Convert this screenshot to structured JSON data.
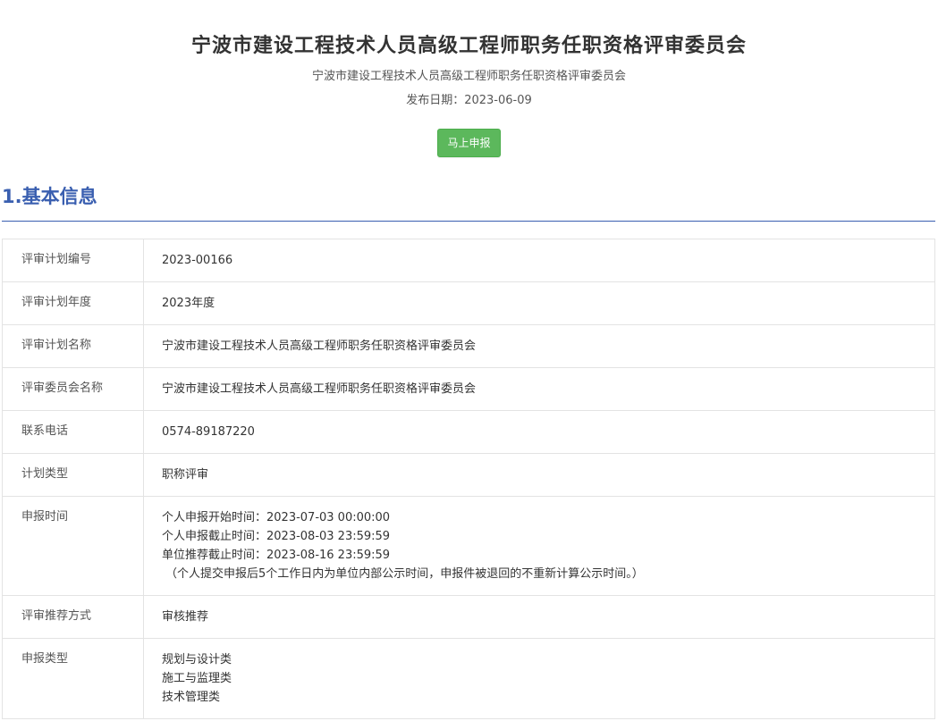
{
  "header": {
    "title": "宁波市建设工程技术人员高级工程师职务任职资格评审委员会",
    "subtitle": "宁波市建设工程技术人员高级工程师职务任职资格评审委员会",
    "publish_date": "发布日期：2023-06-09",
    "apply_button": "马上申报"
  },
  "section": {
    "title": "1.基本信息"
  },
  "info": {
    "plan_number": {
      "label": "评审计划编号",
      "value": "2023-00166"
    },
    "plan_year": {
      "label": "评审计划年度",
      "value": "2023年度"
    },
    "plan_name": {
      "label": "评审计划名称",
      "value": "宁波市建设工程技术人员高级工程师职务任职资格评审委员会"
    },
    "committee_name": {
      "label": "评审委员会名称",
      "value": "宁波市建设工程技术人员高级工程师职务任职资格评审委员会"
    },
    "phone": {
      "label": "联系电话",
      "value": "0574-89187220"
    },
    "plan_type": {
      "label": "计划类型",
      "value": "职称评审"
    },
    "apply_time": {
      "label": "申报时间",
      "lines": [
        "个人申报开始时间：2023-07-03 00:00:00",
        "个人申报截止时间：2023-08-03 23:59:59",
        "单位推荐截止时间：2023-08-16 23:59:59"
      ],
      "note": "（个人提交申报后5个工作日内为单位内部公示时间，申报件被退回的不重新计算公示时间。）"
    },
    "recommend_method": {
      "label": "评审推荐方式",
      "value": "审核推荐"
    },
    "apply_type": {
      "label": "申报类型",
      "lines": [
        "规划与设计类",
        "施工与监理类",
        "技术管理类"
      ]
    }
  },
  "colors": {
    "accent": "#3a5fb0",
    "button": "#5cb85c",
    "border": "#e3e3e3"
  }
}
